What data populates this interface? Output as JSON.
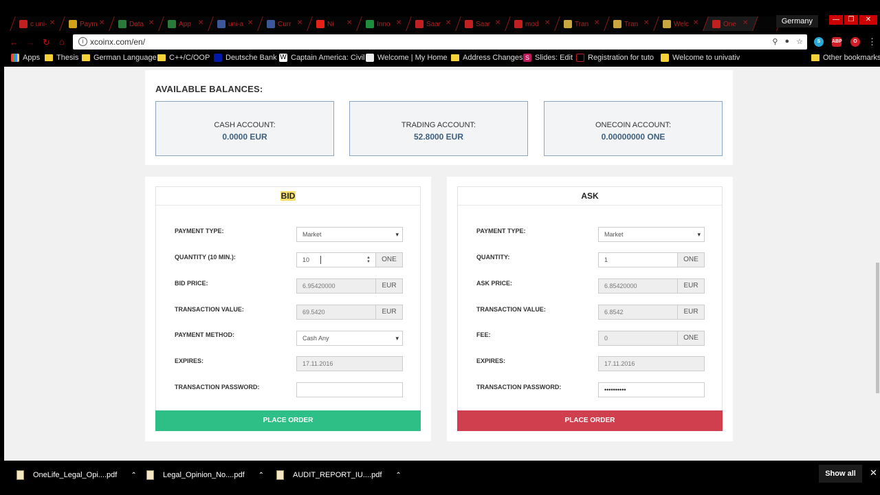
{
  "browser": {
    "tabs": [
      {
        "label": "c uni-",
        "fav": "#c02020"
      },
      {
        "label": "Paym",
        "fav": "#d2a21a"
      },
      {
        "label": "Data",
        "fav": "#2a7b3a"
      },
      {
        "label": "App",
        "fav": "#2a7b3a"
      },
      {
        "label": "uni-a",
        "fav": "#3b5998"
      },
      {
        "label": "Curr",
        "fav": "#3b5998"
      },
      {
        "label": "Ni",
        "fav": "#e62117"
      },
      {
        "label": "Inno",
        "fav": "#1e8e3e"
      },
      {
        "label": "Saar",
        "fav": "#c02020"
      },
      {
        "label": "Saar",
        "fav": "#c02020"
      },
      {
        "label": "mod",
        "fav": "#c02020"
      },
      {
        "label": "Tran",
        "fav": "#caa640"
      },
      {
        "label": "Tran",
        "fav": "#caa640"
      },
      {
        "label": "Welc",
        "fav": "#caa640"
      },
      {
        "label": "One",
        "fav": "#c02020"
      }
    ],
    "profile": "Germany",
    "url": "xcoinx.com/en/",
    "bookmarks": [
      "Apps",
      "Thesis",
      "German Language",
      "C++/C/OOP",
      "Deutsche Bank",
      "Captain America: Civil",
      "Welcome | My Home",
      "Address Changes",
      "Slides: Edit",
      "Registration for tuto",
      "Welcome to univativ",
      "Other bookmarks"
    ]
  },
  "balances": {
    "title": "AVAILABLE BALANCES:",
    "cash_label": "CASH ACCOUNT:",
    "cash_value": "0.0000 EUR",
    "trading_label": "TRADING ACCOUNT:",
    "trading_value": "52.8000 EUR",
    "onecoin_label": "ONECOIN ACCOUNT:",
    "onecoin_value": "0.00000000 ONE"
  },
  "bid": {
    "title": "BID",
    "payment_type_label": "PAYMENT TYPE:",
    "payment_type_value": "Market",
    "quantity_label": "QUANTITY (10 MIN.):",
    "quantity_value": "10",
    "quantity_unit": "ONE",
    "price_label": "BID PRICE:",
    "price_value": "6.95420000",
    "price_unit": "EUR",
    "tx_value_label": "TRANSACTION VALUE:",
    "tx_value_value": "69.5420",
    "tx_value_unit": "EUR",
    "method_label": "PAYMENT METHOD:",
    "method_value": "Cash Any",
    "expires_label": "EXPIRES:",
    "expires_value": "17.11.2016",
    "password_label": "TRANSACTION PASSWORD:",
    "password_value": "",
    "button": "PLACE ORDER",
    "button_color": "#2ebf86"
  },
  "ask": {
    "title": "ASK",
    "payment_type_label": "PAYMENT TYPE:",
    "payment_type_value": "Market",
    "quantity_label": "QUANTITY:",
    "quantity_value": "1",
    "quantity_unit": "ONE",
    "price_label": "ASK PRICE:",
    "price_value": "6.85420000",
    "price_unit": "EUR",
    "tx_value_label": "TRANSACTION VALUE:",
    "tx_value_value": "6.8542",
    "tx_value_unit": "EUR",
    "fee_label": "FEE:",
    "fee_value": "0",
    "fee_unit": "ONE",
    "expires_label": "EXPIRES:",
    "expires_value": "17.11.2016",
    "password_label": "TRANSACTION PASSWORD:",
    "password_value": "••••••••••",
    "button": "PLACE ORDER",
    "button_color": "#cf3f4e"
  },
  "downloads": {
    "items": [
      "OneLife_Legal_Opi....pdf",
      "Legal_Opinion_No....pdf",
      "AUDIT_REPORT_IU....pdf"
    ],
    "show_all": "Show all"
  }
}
